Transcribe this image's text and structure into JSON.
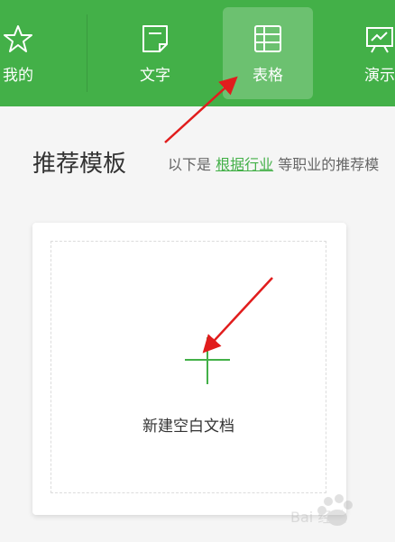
{
  "colors": {
    "brand_green": "#43b048",
    "arrow_red": "#e11d1d"
  },
  "tabs": [
    {
      "label": "我的",
      "icon": "star-icon"
    },
    {
      "label": "文字",
      "icon": "document-icon"
    },
    {
      "label": "表格",
      "icon": "table-icon",
      "active": true
    },
    {
      "label": "演示",
      "icon": "presentation-icon"
    }
  ],
  "section": {
    "title": "推荐模板",
    "desc_prefix": "以下是",
    "desc_link": "根据行业",
    "desc_suffix": "等职业的推荐模"
  },
  "card": {
    "label": "新建空白文档"
  },
  "watermark": {
    "text": "Bai 经验"
  }
}
